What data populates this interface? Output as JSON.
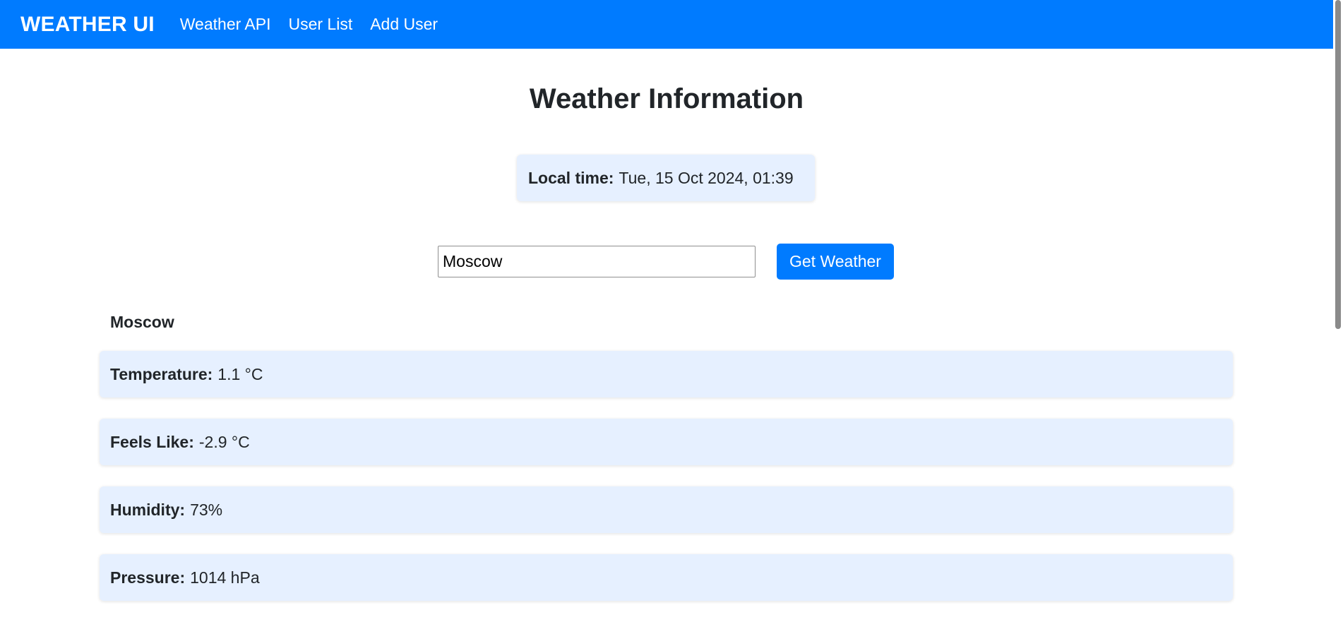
{
  "navbar": {
    "brand": "WEATHER UI",
    "links": [
      {
        "label": "Weather API"
      },
      {
        "label": "User List"
      },
      {
        "label": "Add User"
      }
    ]
  },
  "main": {
    "title": "Weather Information",
    "local_time": {
      "label": "Local time:",
      "value": "Tue, 15 Oct 2024, 01:39"
    },
    "search": {
      "value": "Moscow",
      "button_label": "Get Weather"
    },
    "city": "Moscow",
    "weather_items": [
      {
        "label": "Temperature:",
        "value": "1.1 °C"
      },
      {
        "label": "Feels Like:",
        "value": "-2.9 °C"
      },
      {
        "label": "Humidity:",
        "value": "73%"
      },
      {
        "label": "Pressure:",
        "value": "1014 hPa"
      }
    ]
  },
  "colors": {
    "primary": "#007bff",
    "card_background": "#e6f0ff",
    "text": "#212529"
  }
}
